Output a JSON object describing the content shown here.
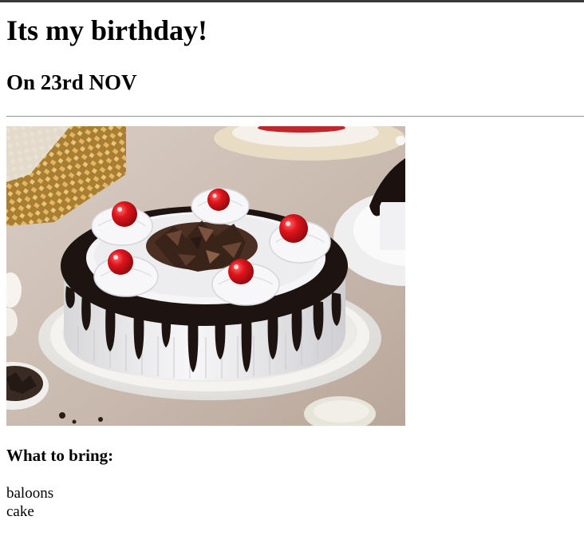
{
  "page": {
    "title": "Its my birthday!",
    "date_heading": "On 23rd NOV",
    "section_heading": "What to bring:",
    "bring_items": [
      "baloons",
      "cake"
    ]
  },
  "image": {
    "subject": "black forest cake with cream rosettes, cherries and chocolate drip on a white plate",
    "colors": {
      "background": "#cdbfb5",
      "plate": "#f3f1ee",
      "cream": "#f4f4f6",
      "chocolate": "#1d1411",
      "cherry": "#d5131a",
      "gold": "#c79a3e"
    }
  }
}
